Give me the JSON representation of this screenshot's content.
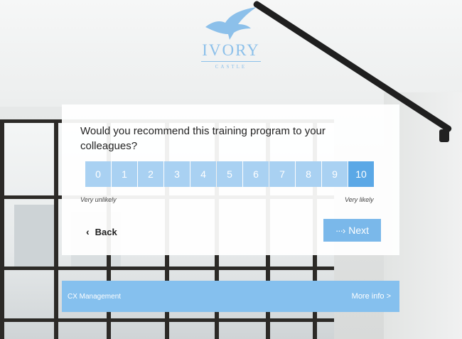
{
  "logo": {
    "name": "IVORY",
    "sub": "CASTLE",
    "icon": "bird-icon"
  },
  "survey": {
    "question": "Would you recommend this training program to your colleagues?",
    "scale": [
      "0",
      "1",
      "2",
      "3",
      "4",
      "5",
      "6",
      "7",
      "8",
      "9",
      "10"
    ],
    "selected_value": "10",
    "low_label": "Very unlikely",
    "high_label": "Very likely",
    "back_label": "Back",
    "next_label": "Next"
  },
  "footer": {
    "left_text": "CX Management",
    "right_text": "More info >"
  },
  "colors": {
    "accent": "#7ab8ea",
    "scale_button": "#a9d1f2",
    "scale_selected": "#5ba8e6",
    "footer": "#85c0ee"
  }
}
